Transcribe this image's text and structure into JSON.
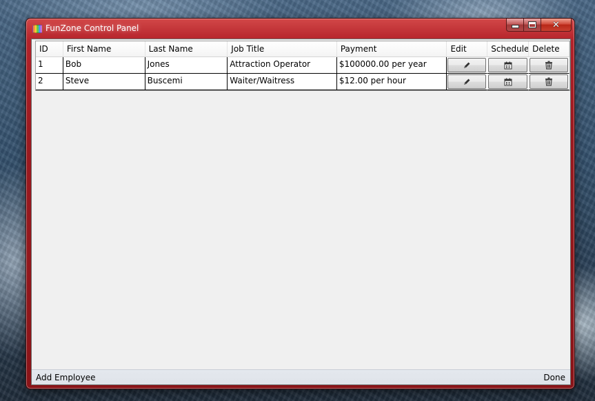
{
  "window": {
    "title": "FunZone Control Panel",
    "close_glyph": "✕"
  },
  "table": {
    "columns": [
      "ID",
      "First Name",
      "Last Name",
      "Job Title",
      "Payment",
      "Edit",
      "Schedule",
      "Delete"
    ],
    "rows": [
      {
        "id": "1",
        "first_name": "Bob",
        "last_name": "Jones",
        "job_title": "Attraction Operator",
        "payment": "$100000.00 per year"
      },
      {
        "id": "2",
        "first_name": "Steve",
        "last_name": "Buscemi",
        "job_title": "Waiter/Waitress",
        "payment": "$12.00 per hour"
      }
    ],
    "row_action_icons": [
      "pencil-icon",
      "calendar-icon",
      "trash-icon"
    ]
  },
  "statusbar": {
    "add_label": "Add Employee",
    "done_label": "Done"
  }
}
